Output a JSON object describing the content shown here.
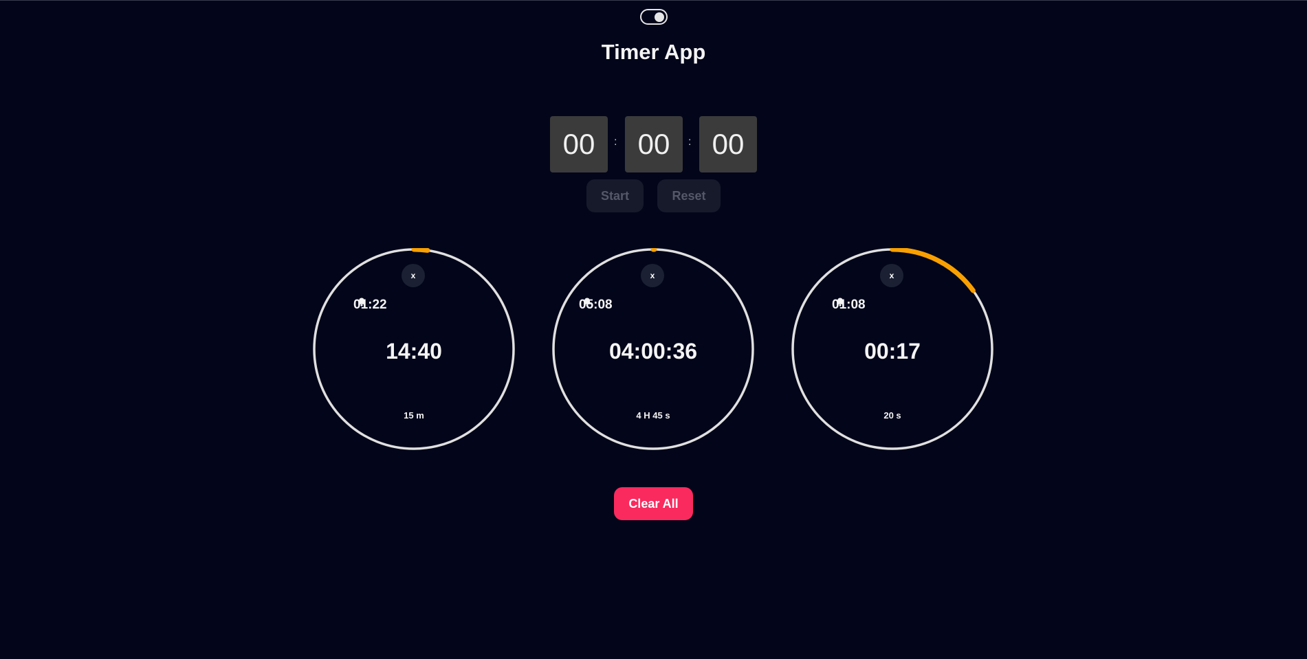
{
  "app": {
    "title": "Timer App"
  },
  "theme_toggle": {
    "state": "on",
    "icon": "toggle-switch-icon"
  },
  "time_input": {
    "hours": "00",
    "minutes": "00",
    "seconds": "00",
    "separator": ":"
  },
  "controls": {
    "start_label": "Start",
    "reset_label": "Reset"
  },
  "colors": {
    "background": "#03061a",
    "ring": "#e0e0e0",
    "progress": "#f9a000",
    "accent": "#fa2a5e"
  },
  "timers": [
    {
      "close_label": "x",
      "alarm_time": "01:22",
      "alarm_icon": "bell-icon",
      "remaining": "14:40",
      "duration": "15 m",
      "progress": 0.022
    },
    {
      "close_label": "x",
      "alarm_time": "05:08",
      "alarm_icon": "bell-icon",
      "remaining": "04:00:36",
      "duration": "4 H 45 s",
      "progress": 0.002
    },
    {
      "close_label": "x",
      "alarm_time": "01:08",
      "alarm_icon": "bell-icon",
      "remaining": "00:17",
      "duration": "20 s",
      "progress": 0.15
    }
  ],
  "footer": {
    "clear_all_label": "Clear All"
  }
}
